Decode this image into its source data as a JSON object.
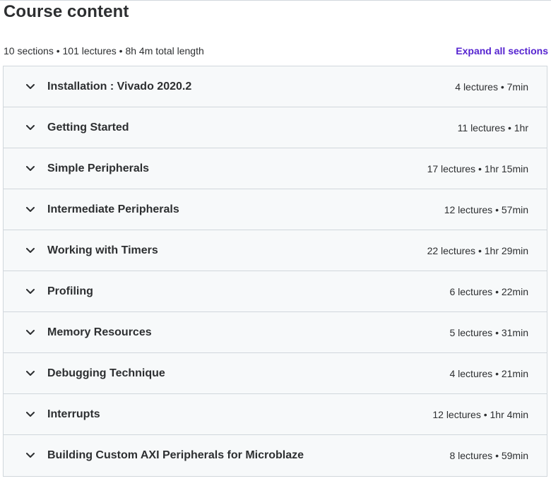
{
  "header": {
    "title": "Course content"
  },
  "summary": {
    "text": "10 sections • 101 lectures • 8h 4m total length",
    "expand_label": "Expand all sections"
  },
  "colors": {
    "accent": "#5624d0",
    "text": "#2d2f31",
    "section_bg": "#f7f9fa",
    "border": "#d1d7dc"
  },
  "sections": [
    {
      "title": "Installation : Vivado 2020.2",
      "meta": "4 lectures • 7min",
      "icon": "chevron-down-icon"
    },
    {
      "title": "Getting Started",
      "meta": "11 lectures • 1hr",
      "icon": "chevron-down-icon"
    },
    {
      "title": "Simple Peripherals",
      "meta": "17 lectures • 1hr 15min",
      "icon": "chevron-down-icon"
    },
    {
      "title": "Intermediate Peripherals",
      "meta": "12 lectures • 57min",
      "icon": "chevron-down-icon"
    },
    {
      "title": "Working with Timers",
      "meta": "22 lectures • 1hr 29min",
      "icon": "chevron-down-icon"
    },
    {
      "title": "Profiling",
      "meta": "6 lectures • 22min",
      "icon": "chevron-down-icon"
    },
    {
      "title": "Memory Resources",
      "meta": "5 lectures • 31min",
      "icon": "chevron-down-icon"
    },
    {
      "title": "Debugging Technique",
      "meta": "4 lectures • 21min",
      "icon": "chevron-down-icon"
    },
    {
      "title": "Interrupts",
      "meta": "12 lectures • 1hr 4min",
      "icon": "chevron-down-icon"
    },
    {
      "title": "Building Custom AXI Peripherals for Microblaze",
      "meta": "8 lectures • 59min",
      "icon": "chevron-down-icon"
    }
  ]
}
